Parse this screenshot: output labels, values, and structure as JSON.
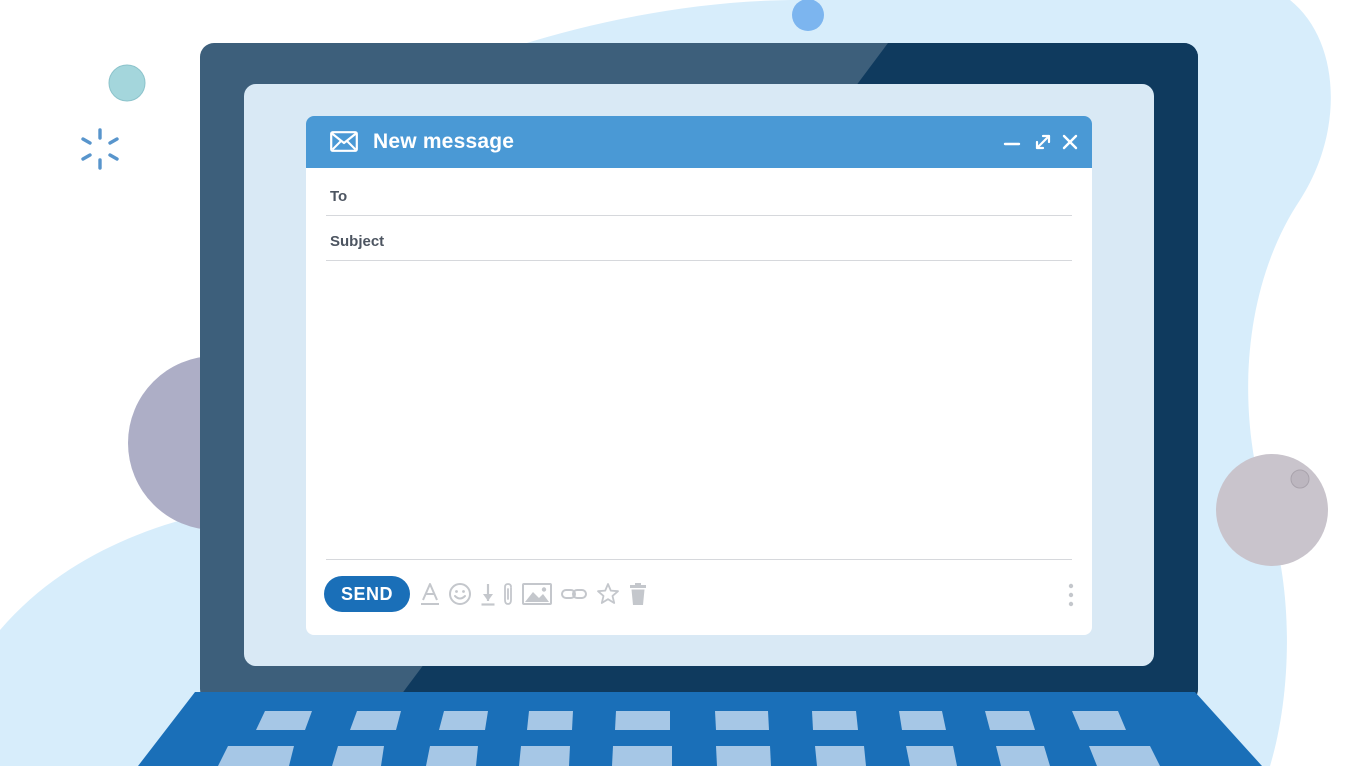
{
  "compose": {
    "title": "New message",
    "to_label": "To",
    "to_value": "",
    "subject_label": "Subject",
    "subject_value": "",
    "body_value": "",
    "send_label": "SEND"
  },
  "toolbar_icons": [
    "text-format-icon",
    "emoji-icon",
    "download-icon",
    "attach-icon",
    "image-icon",
    "link-icon",
    "star-icon",
    "trash-icon",
    "more-options-icon"
  ],
  "window_controls": [
    "minimize-icon",
    "expand-icon",
    "close-icon"
  ],
  "colors": {
    "title_bar": "#4a99d5",
    "send_button": "#1a6fb8",
    "screen": "#d9e9f5",
    "bezel": "#3d5f7b",
    "bezel_dark": "#0f3a5e",
    "keyboard": "#1a6fb8",
    "background_blob": "#d7edfb"
  }
}
